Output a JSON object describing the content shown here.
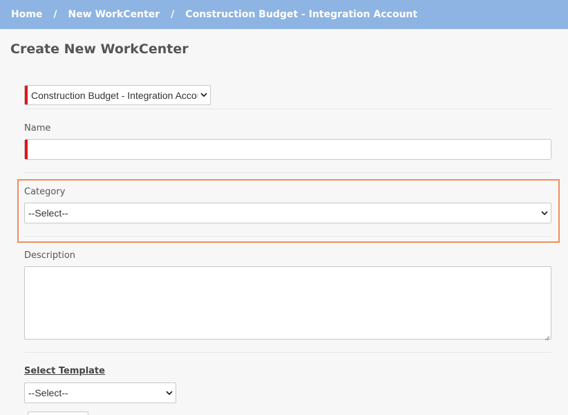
{
  "breadcrumb": {
    "items": [
      "Home",
      "New WorkCenter",
      "Construction Budget - Integration Account"
    ],
    "separator": "/"
  },
  "page": {
    "title": "Create New WorkCenter"
  },
  "form": {
    "account": {
      "value": "Construction Budget - Integration Account",
      "required": true
    },
    "name": {
      "label": "Name",
      "value": "",
      "required": true
    },
    "category": {
      "label": "Category",
      "value": "--Select--"
    },
    "description": {
      "label": "Description",
      "value": ""
    },
    "template": {
      "label": "Select Template",
      "value": "--Select--"
    }
  },
  "colors": {
    "header_bg": "#8db4e2",
    "required_marker": "#e0141b",
    "highlight_border": "#f08d5a",
    "page_bg": "#f7f7f7"
  },
  "icons": {
    "select_arrow": "chevron-down-icon",
    "resize": "resize-grip-icon"
  }
}
